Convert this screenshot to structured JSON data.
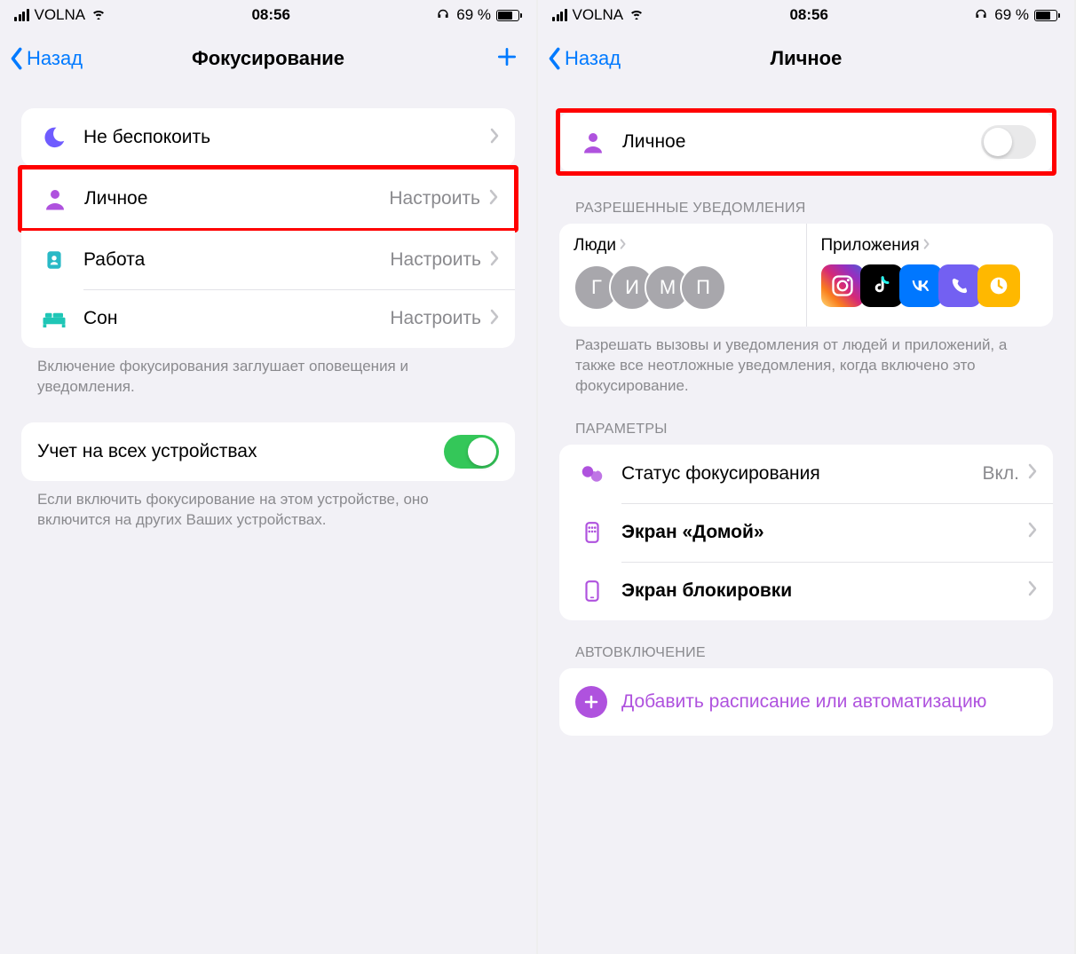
{
  "status": {
    "carrier": "VOLNA",
    "time": "08:56",
    "battery_pct": "69 %"
  },
  "left": {
    "nav_back": "Назад",
    "nav_title": "Фокусирование",
    "items": [
      {
        "label": "Не беспокоить",
        "value": ""
      },
      {
        "label": "Личное",
        "value": "Настроить"
      },
      {
        "label": "Работа",
        "value": "Настроить"
      },
      {
        "label": "Сон",
        "value": "Настроить"
      }
    ],
    "footer1": "Включение фокусирования заглушает оповещения и уведомления.",
    "sync_label": "Учет на всех устройствах",
    "footer2": "Если включить фокусирование на этом устройстве, оно включится на других Ваших устройствах."
  },
  "right": {
    "nav_back": "Назад",
    "nav_title": "Личное",
    "main_label": "Личное",
    "section_notifications": "РАЗРЕШЕННЫЕ УВЕДОМЛЕНИЯ",
    "people_title": "Люди",
    "people": [
      "Г",
      "И",
      "М",
      "П"
    ],
    "apps_title": "Приложения",
    "notif_footer": "Разрешать вызовы и уведомления от людей и приложений, а также все неотложные уведомления, когда включено это фокусирование.",
    "section_params": "ПАРАМЕТРЫ",
    "params": [
      {
        "label": "Статус фокусирования",
        "value": "Вкл."
      },
      {
        "label": "Экран «Домой»",
        "value": ""
      },
      {
        "label": "Экран блокировки",
        "value": ""
      }
    ],
    "section_auto": "АВТОВКЛЮЧЕНИЕ",
    "add_schedule": "Добавить расписание или автоматизацию"
  }
}
